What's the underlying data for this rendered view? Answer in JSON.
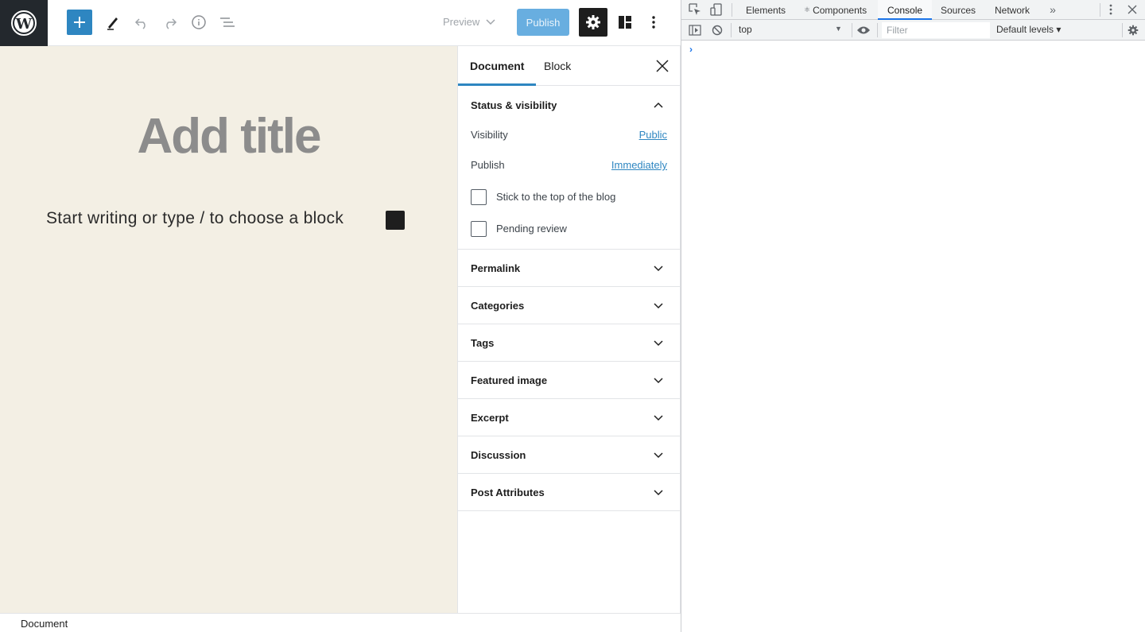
{
  "editor": {
    "toolbar": {
      "preview_label": "Preview",
      "publish_label": "Publish"
    },
    "canvas": {
      "title_placeholder": "Add title",
      "paragraph_placeholder": "Start writing or type / to choose a block"
    },
    "sidebar": {
      "tabs": [
        {
          "label": "Document",
          "active": true
        },
        {
          "label": "Block",
          "active": false
        }
      ],
      "status_panel": {
        "title": "Status & visibility",
        "visibility_label": "Visibility",
        "visibility_value": "Public",
        "publish_label": "Publish",
        "publish_value": "Immediately",
        "sticky_label": "Stick to the top of the blog",
        "pending_label": "Pending review"
      },
      "panels": [
        "Permalink",
        "Categories",
        "Tags",
        "Featured image",
        "Excerpt",
        "Discussion",
        "Post Attributes"
      ]
    },
    "statusbar": {
      "breadcrumb": "Document"
    },
    "colors": {
      "accent": "#2e86c1",
      "canvas_bg": "#f3efe4"
    }
  },
  "devtools": {
    "tabs": [
      {
        "label": "Elements",
        "active": false
      },
      {
        "label": "Components",
        "active": false
      },
      {
        "label": "Console",
        "active": true
      },
      {
        "label": "Sources",
        "active": false
      },
      {
        "label": "Network",
        "active": false
      }
    ],
    "context": "top",
    "filter_placeholder": "Filter",
    "levels": "Default levels ▾",
    "prompt": "›"
  }
}
